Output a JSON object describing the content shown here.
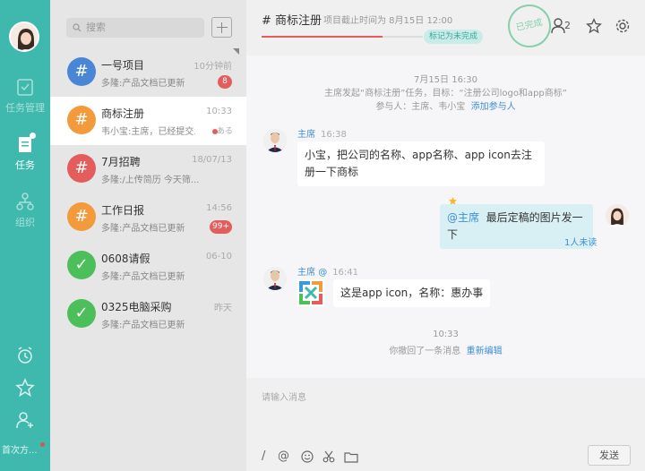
{
  "sidebar": {
    "nav": [
      {
        "label": "任务管理",
        "icon": "clipboard-icon"
      },
      {
        "label": "任务",
        "icon": "document-icon"
      },
      {
        "label": "组织",
        "icon": "org-icon"
      }
    ],
    "bottom_icons": [
      "alarm-icon",
      "star-icon",
      "add-user-icon"
    ],
    "status_text": "首次方..."
  },
  "search": {
    "placeholder": "搜索"
  },
  "conversations": [
    {
      "title": "一号项目",
      "time": "10分钟前",
      "preview": "多隆:产品文档已更新",
      "badge": "8",
      "color": "#4a86d6",
      "icon": "#"
    },
    {
      "title": "商标注册",
      "time": "10:33",
      "preview": "韦小宝:主席，已经提交...",
      "mini": "ある",
      "color": "#f39a3c",
      "icon": "#"
    },
    {
      "title": "7月招聘",
      "time": "18/07/13",
      "preview": "多隆:/上传简历 今天筛...",
      "color": "#e35d5d",
      "icon": "#"
    },
    {
      "title": "工作日报",
      "time": "14:56",
      "preview": "多隆:产品文档已更新",
      "badge": "99+",
      "color": "#f39a3c",
      "icon": "#"
    },
    {
      "title": "0608请假",
      "time": "06-10",
      "preview": "多隆:产品文档已更新",
      "color": "#4cbf5b",
      "icon": "✓"
    },
    {
      "title": "0325电脑采购",
      "time": "昨天",
      "preview": "多隆:产品文档已更新",
      "color": "#4cbf5b",
      "icon": "✓"
    }
  ],
  "header": {
    "title": "# 商标注册",
    "deadline": "项目截止时间为 8月15日 12:00",
    "progress": 0.75,
    "mark_done": "标记为未完成",
    "stamp": "已完成",
    "member_count": "2"
  },
  "chat": {
    "system": {
      "date": "7月15日 16:30",
      "line1": "主席发起“商标注册”任务，目标：“注册公司logo和app商标”",
      "participants_label": "参与人：主席、韦小宝",
      "add_participant": "添加参与人"
    },
    "messages": [
      {
        "sender": "主席",
        "time": "16:38",
        "lines": [
          "小宝，把公司的名称、app名称、app icon去注",
          "册一下商标"
        ]
      },
      {
        "sender": "主席",
        "time": "16:41",
        "at_prefix": "@",
        "text": "这是app icon，名称：惠办事"
      }
    ],
    "my_message": {
      "at": "@主席",
      "text": "最后定稿的图片发一下",
      "status": "1人未读"
    },
    "recall": {
      "time": "10:33",
      "text": "你撤回了一条消息",
      "action": "重新编辑"
    }
  },
  "composer": {
    "placeholder": "请输入消息",
    "send_label": "发送"
  }
}
